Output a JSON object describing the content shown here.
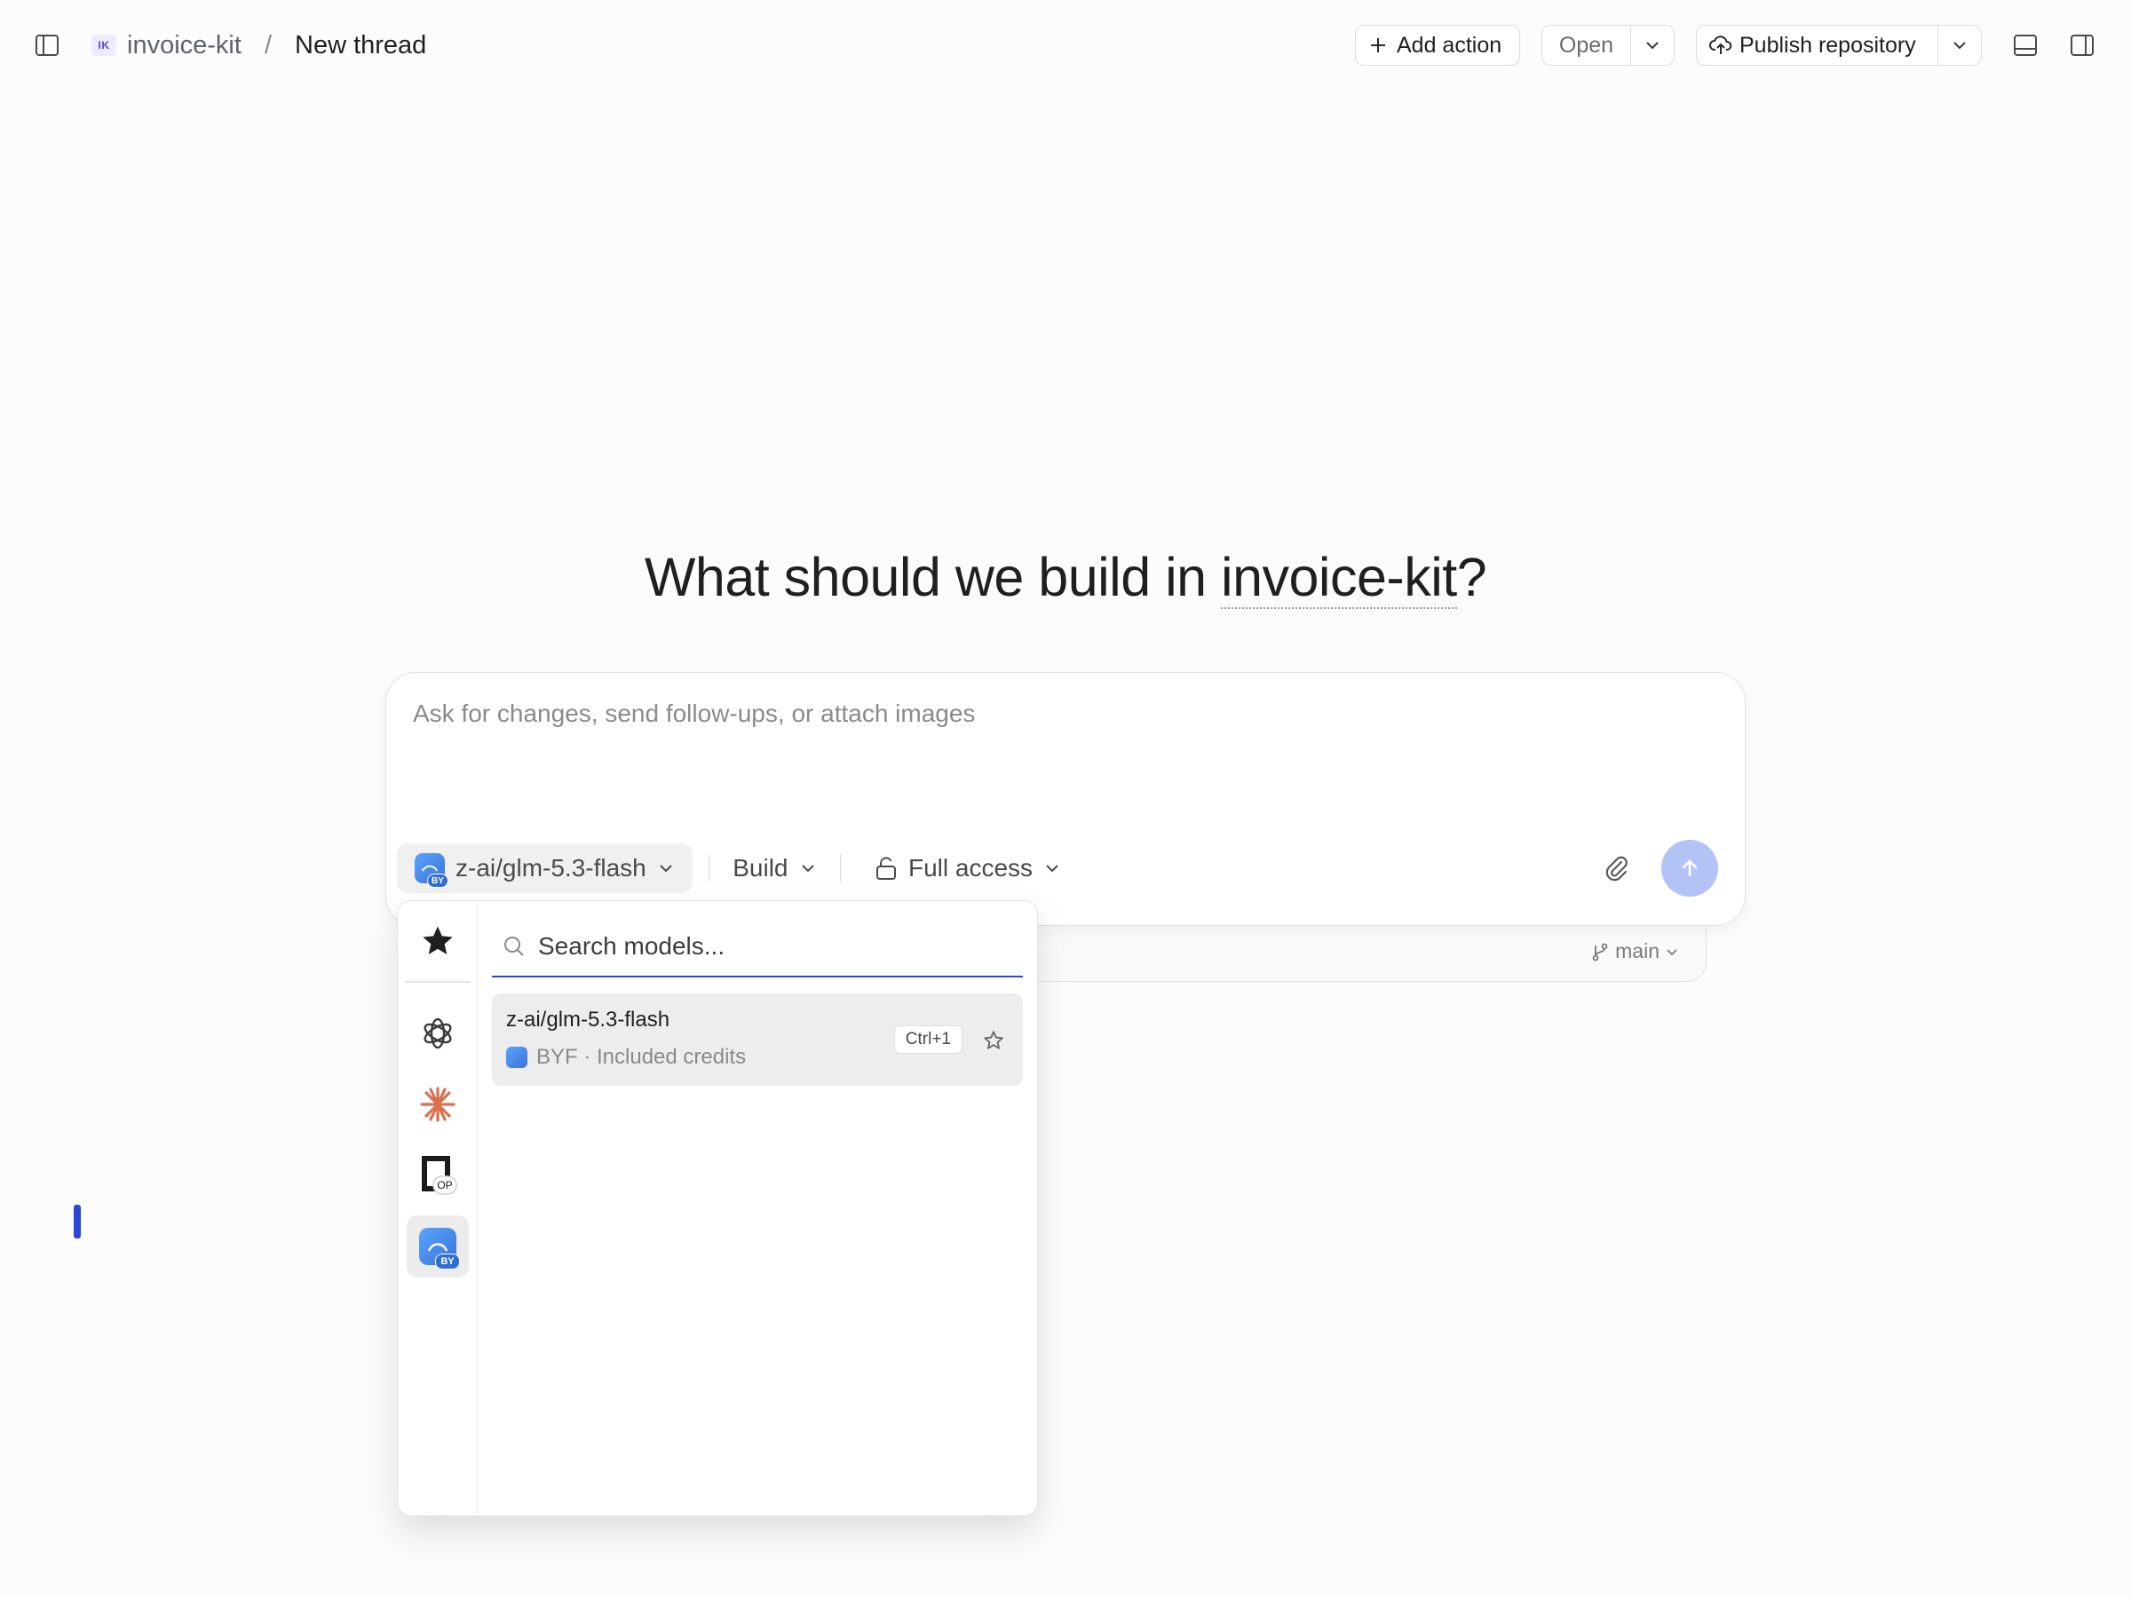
{
  "header": {
    "project_badge": "IK",
    "project": "invoice-kit",
    "separator": "/",
    "thread": "New thread",
    "add_action": "Add action",
    "open": "Open",
    "publish": "Publish repository"
  },
  "main": {
    "heading_prefix": "What should we build in ",
    "heading_project": "invoice-kit",
    "heading_suffix": "?"
  },
  "composer": {
    "placeholder": "Ask for changes, send follow-ups, or attach images",
    "model": "z-ai/glm-5.3-flash",
    "model_provider_badge": "BY",
    "mode": "Build",
    "access": "Full access",
    "branch": "main"
  },
  "model_menu": {
    "search_placeholder": "Search models...",
    "providers": [
      {
        "name": "favorites",
        "icon": "star-icon"
      },
      {
        "name": "openai",
        "icon": "openai-icon"
      },
      {
        "name": "anthropic",
        "icon": "claude-icon"
      },
      {
        "name": "openrouter",
        "icon": "openrouter-icon",
        "badge": "OP"
      },
      {
        "name": "byf",
        "icon": "byf-icon",
        "badge": "BY",
        "active": true
      }
    ],
    "models": [
      {
        "name": "z-ai/glm-5.3-flash",
        "provider": "BYF",
        "meta": "BYF · Included credits",
        "shortcut": "Ctrl+1"
      }
    ]
  },
  "colors": {
    "accent": "#2b46d8",
    "send_disabled": "#b3c3f5",
    "claude": "#d9704f"
  }
}
